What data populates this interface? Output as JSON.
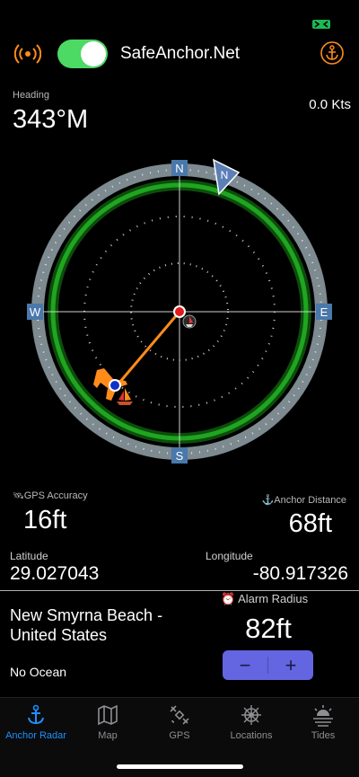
{
  "header": {
    "title": "SafeAnchor.Net",
    "toggle_on": true,
    "accent_color": "#ff8c1a"
  },
  "heading": {
    "label": "Heading",
    "value": "343°M"
  },
  "speed": "0.0 Kts",
  "radar": {
    "north": "N",
    "south": "S",
    "east": "E",
    "west": "W",
    "heading_marker": "N",
    "alarm_ring_color": "#1fa51f",
    "track_color": "#ff8c1a"
  },
  "gps_accuracy": {
    "label": "GPS Accuracy",
    "value": "16ft"
  },
  "anchor_distance": {
    "label": "Anchor Distance",
    "value": "68ft"
  },
  "latitude": {
    "label": "Latitude",
    "value": "29.027043"
  },
  "longitude": {
    "label": "Longitude",
    "value": "-80.917326"
  },
  "location": {
    "name": "New Smyrna Beach - United States",
    "ocean": "No Ocean"
  },
  "alarm": {
    "label": "Alarm Radius",
    "value": "82ft",
    "minus": "−",
    "plus": "+"
  },
  "tabs": [
    {
      "label": "Anchor Radar",
      "icon": "anchor-icon",
      "active": true
    },
    {
      "label": "Map",
      "icon": "map-icon",
      "active": false
    },
    {
      "label": "GPS",
      "icon": "satellite-icon",
      "active": false
    },
    {
      "label": "Locations",
      "icon": "helm-icon",
      "active": false
    },
    {
      "label": "Tides",
      "icon": "sunset-icon",
      "active": false
    }
  ]
}
